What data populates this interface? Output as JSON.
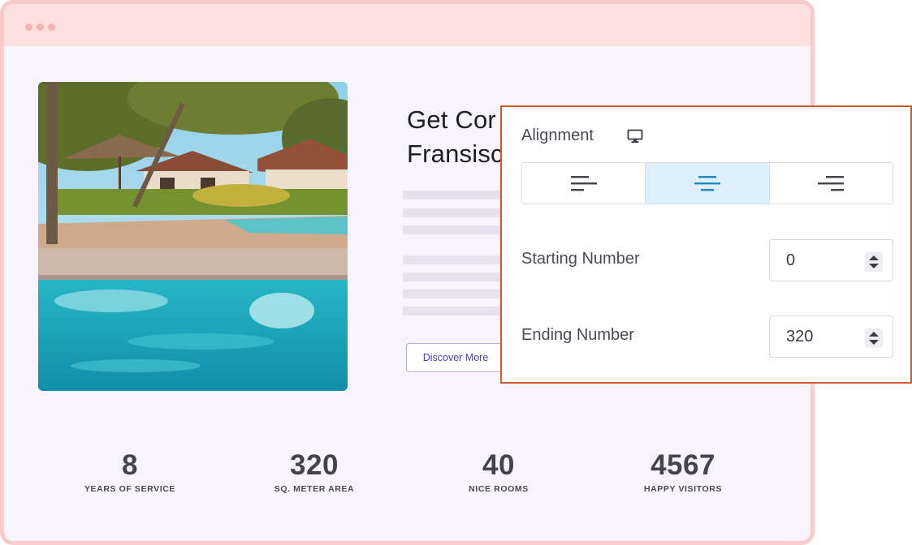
{
  "hero": {
    "headline": "Get Cor\nFransisc",
    "button_label": "Discover More"
  },
  "stats": [
    {
      "value": "8",
      "label": "YEARS OF SERVICE"
    },
    {
      "value": "320",
      "label": "SQ. METER AREA"
    },
    {
      "value": "40",
      "label": "NICE ROOMS"
    },
    {
      "value": "4567",
      "label": "HAPPY VISITORS"
    }
  ],
  "panel": {
    "alignment_label": "Alignment",
    "alignment_icon": "desktop-monitor-icon",
    "alignment_options": [
      "align-left",
      "align-center",
      "align-right"
    ],
    "alignment_selected": "align-center",
    "starting_label": "Starting Number",
    "starting_value": "0",
    "ending_label": "Ending Number",
    "ending_value": "320"
  },
  "colors": {
    "frame_border": "#f9cccb",
    "frame_bar": "#fde1df",
    "page_bg": "#f7f4fd",
    "panel_border": "#cf5a2f",
    "active_align_bg": "#dceffa",
    "active_align_icon": "#1e88c7",
    "button_text": "#4a3bbd"
  }
}
